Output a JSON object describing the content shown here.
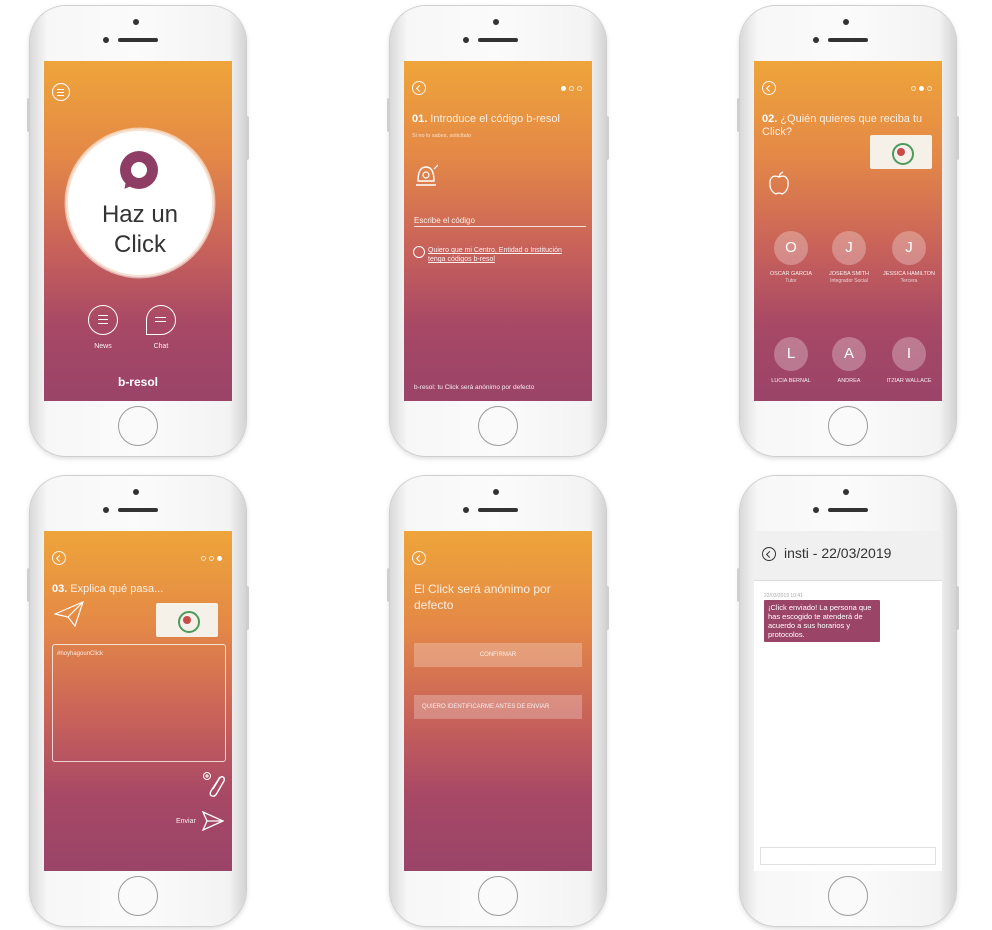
{
  "screen1": {
    "cta_line1": "Haz un",
    "cta_line2": "Click",
    "news_label": "News",
    "chat_label": "Chat",
    "brand": "b-resol"
  },
  "screen2": {
    "step_num": "01.",
    "step_title": "Introduce el código b-resol",
    "hint": "Si no lo sabes, solicítalo",
    "code_label": "Escribe el código",
    "link_text": "Quiero que mi Centro, Entidad o Institución tenga códigos b-resol",
    "footer": "b-resol: tu Click será anónimo por defecto"
  },
  "screen3": {
    "step_num": "02.",
    "step_title": "¿Quién quieres que reciba tu Click?",
    "recipients": [
      {
        "initial": "O",
        "name": "OSCAR GARCIA",
        "role": "Tutor"
      },
      {
        "initial": "J",
        "name": "JOSEBA SMITH",
        "role": "Integrador Social"
      },
      {
        "initial": "J",
        "name": "JESSICA HAMILTON",
        "role": "Tercera"
      },
      {
        "initial": "L",
        "name": "LUCIA BERNAL",
        "role": ""
      },
      {
        "initial": "A",
        "name": "ANDREA",
        "role": ""
      },
      {
        "initial": "I",
        "name": "ITZIAR WALLACE",
        "role": ""
      }
    ]
  },
  "screen4": {
    "step_num": "03.",
    "step_title": "Explica qué pasa...",
    "placeholder": "#hoyhagounClick",
    "send_label": "Enviar"
  },
  "screen5": {
    "message": "El Click será anónimo por defecto",
    "confirm_label": "CONFIRMAR",
    "identify_label": "QUIERO IDENTIFICARME ANTES DE ENVIAR"
  },
  "screen6": {
    "title": "insti - 22/03/2019",
    "timestamp": "22/03/2019 10:41",
    "message": "¡Click enviado! La persona que has escogido te atenderá de acuerdo a sus horarios y protocolos."
  },
  "colors": {
    "gradient_top": "#eea53a",
    "gradient_bottom": "#9a4468",
    "brand_purple": "#8e3d64"
  }
}
